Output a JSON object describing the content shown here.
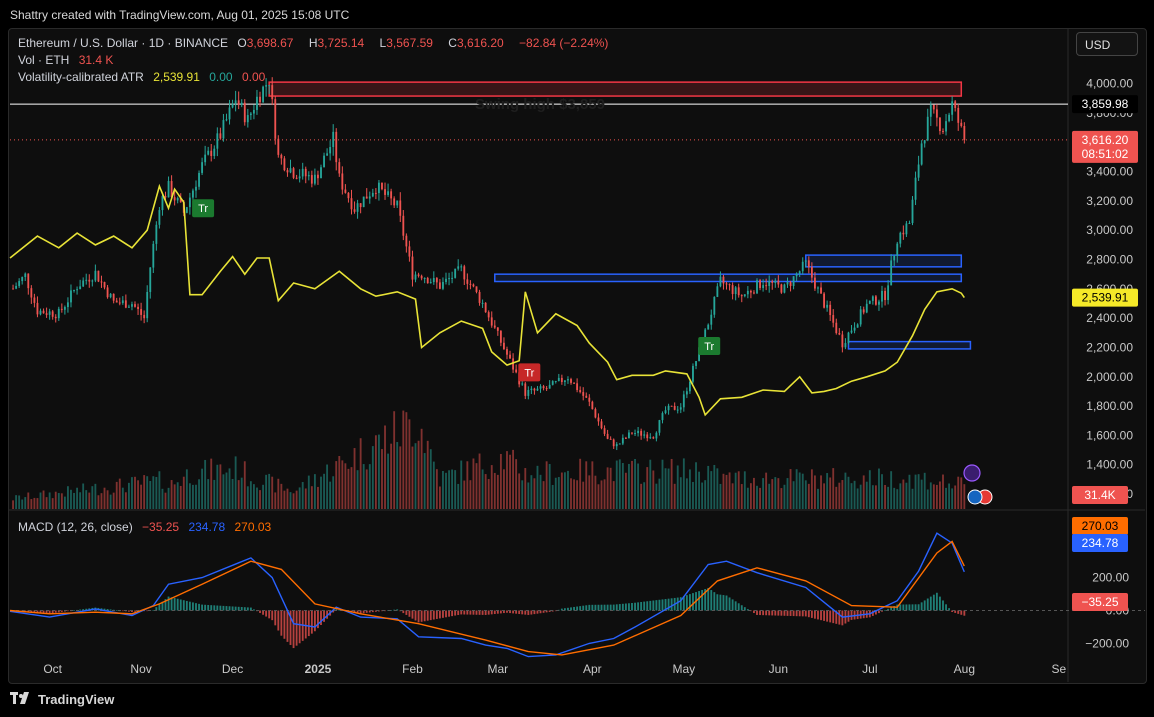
{
  "header": {
    "attribution": "Shattry created with TradingView.com, Aug 01, 2025 15:08 UTC"
  },
  "legend": {
    "symbol": "Ethereum / U.S. Dollar · 1D · BINANCE",
    "o_label": "O",
    "o_val": "3,698.67",
    "h_label": "H",
    "h_val": "3,725.14",
    "l_label": "L",
    "l_val": "3,567.59",
    "c_label": "C",
    "c_val": "3,616.20",
    "chg": "−82.84 (−2.24%)",
    "vol_label": "Vol · ETH",
    "vol_val": "31.4 K",
    "atr_label": "Volatility-calibrated ATR",
    "atr_val": "2,539.91",
    "atr_v2": "0.00",
    "atr_v3": "0.00",
    "macd_label": "MACD (12, 26, close)",
    "macd_hist": "−35.25",
    "macd_line": "234.78",
    "macd_signal": "270.03"
  },
  "currency_button": "USD",
  "footer": {
    "brand": "TradingView"
  },
  "colors": {
    "up": "#26a69a",
    "down": "#ef5350",
    "atr": "#e8e337",
    "macd": "#2962ff",
    "signal": "#ff6d00",
    "zone": "#2962ff",
    "resistance": "#f23645"
  },
  "chart_data": {
    "type": "candlestick",
    "title": "Ethereum / U.S. Dollar · 1D · BINANCE",
    "x_labels": [
      "Oct",
      "Nov",
      "Dec",
      "2025",
      "Feb",
      "Mar",
      "Apr",
      "May",
      "Jun",
      "Jul",
      "Aug",
      "Se"
    ],
    "y_ticks": [
      "4,000.00",
      "3,800.00",
      "3,600.00",
      "3,400.00",
      "3,200.00",
      "3,000.00",
      "2,800.00",
      "2,600.00",
      "2,400.00",
      "2,200.00",
      "2,000.00",
      "1,800.00",
      "1,600.00",
      "1,400.00",
      "1,200.00"
    ],
    "ylim": [
      1180,
      4120
    ],
    "price_path": [
      [
        "2024-09-22",
        2580
      ],
      [
        "2024-09-27",
        2690
      ],
      [
        "2024-10-01",
        2450
      ],
      [
        "2024-10-08",
        2430
      ],
      [
        "2024-10-14",
        2620
      ],
      [
        "2024-10-20",
        2710
      ],
      [
        "2024-10-26",
        2510
      ],
      [
        "2024-11-01",
        2500
      ],
      [
        "2024-11-05",
        2400
      ],
      [
        "2024-11-07",
        2750
      ],
      [
        "2024-11-10",
        3180
      ],
      [
        "2024-11-13",
        3290
      ],
      [
        "2024-11-18",
        3120
      ],
      [
        "2024-11-24",
        3440
      ],
      [
        "2024-11-30",
        3650
      ],
      [
        "2024-12-05",
        3900
      ],
      [
        "2024-12-09",
        3750
      ],
      [
        "2024-12-12",
        3900
      ],
      [
        "2024-12-16",
        4030
      ],
      [
        "2024-12-19",
        3500
      ],
      [
        "2024-12-24",
        3400
      ],
      [
        "2024-12-31",
        3350
      ],
      [
        "2025-01-06",
        3620
      ],
      [
        "2025-01-08",
        3350
      ],
      [
        "2025-01-13",
        3150
      ],
      [
        "2025-01-20",
        3300
      ],
      [
        "2025-01-27",
        3160
      ],
      [
        "2025-02-01",
        2700
      ],
      [
        "2025-02-04",
        2700
      ],
      [
        "2025-02-10",
        2620
      ],
      [
        "2025-02-17",
        2730
      ],
      [
        "2025-02-24",
        2500
      ],
      [
        "2025-03-04",
        2150
      ],
      [
        "2025-03-10",
        1890
      ],
      [
        "2025-03-17",
        1920
      ],
      [
        "2025-03-24",
        2000
      ],
      [
        "2025-03-31",
        1820
      ],
      [
        "2025-04-06",
        1570
      ],
      [
        "2025-04-09",
        1530
      ],
      [
        "2025-04-14",
        1620
      ],
      [
        "2025-04-21",
        1600
      ],
      [
        "2025-04-25",
        1770
      ],
      [
        "2025-04-30",
        1800
      ],
      [
        "2025-05-08",
        2300
      ],
      [
        "2025-05-13",
        2650
      ],
      [
        "2025-05-20",
        2550
      ],
      [
        "2025-05-27",
        2650
      ],
      [
        "2025-06-03",
        2600
      ],
      [
        "2025-06-10",
        2770
      ],
      [
        "2025-06-16",
        2500
      ],
      [
        "2025-06-22",
        2230
      ],
      [
        "2025-06-30",
        2490
      ],
      [
        "2025-07-06",
        2560
      ],
      [
        "2025-07-10",
        2950
      ],
      [
        "2025-07-14",
        3050
      ],
      [
        "2025-07-18",
        3600
      ],
      [
        "2025-07-21",
        3800
      ],
      [
        "2025-07-25",
        3700
      ],
      [
        "2025-07-28",
        3860
      ],
      [
        "2025-08-01",
        3616
      ]
    ],
    "atr_line": [
      [
        "2024-09-22",
        2810
      ],
      [
        "2024-10-01",
        2960
      ],
      [
        "2024-10-08",
        2880
      ],
      [
        "2024-10-14",
        2980
      ],
      [
        "2024-10-20",
        2900
      ],
      [
        "2024-10-26",
        2960
      ],
      [
        "2024-11-01",
        2880
      ],
      [
        "2024-11-06",
        3000
      ],
      [
        "2024-11-10",
        3300
      ],
      [
        "2024-11-13",
        3150
      ],
      [
        "2024-11-15",
        3280
      ],
      [
        "2024-11-18",
        3190
      ],
      [
        "2024-11-20",
        2560
      ],
      [
        "2024-11-24",
        2560
      ],
      [
        "2024-11-30",
        2720
      ],
      [
        "2024-12-04",
        2820
      ],
      [
        "2024-12-08",
        2700
      ],
      [
        "2024-12-12",
        2810
      ],
      [
        "2024-12-16",
        2810
      ],
      [
        "2024-12-19",
        2520
      ],
      [
        "2024-12-24",
        2640
      ],
      [
        "2024-12-31",
        2600
      ],
      [
        "2025-01-08",
        2720
      ],
      [
        "2025-01-15",
        2600
      ],
      [
        "2025-01-20",
        2550
      ],
      [
        "2025-01-27",
        2580
      ],
      [
        "2025-02-02",
        2530
      ],
      [
        "2025-02-04",
        2200
      ],
      [
        "2025-02-10",
        2300
      ],
      [
        "2025-02-17",
        2380
      ],
      [
        "2025-02-24",
        2330
      ],
      [
        "2025-02-27",
        2170
      ],
      [
        "2025-03-04",
        2080
      ],
      [
        "2025-03-08",
        2110
      ],
      [
        "2025-03-10",
        2580
      ],
      [
        "2025-03-14",
        2300
      ],
      [
        "2025-03-20",
        2430
      ],
      [
        "2025-03-27",
        2350
      ],
      [
        "2025-03-31",
        2230
      ],
      [
        "2025-04-06",
        2100
      ],
      [
        "2025-04-09",
        1980
      ],
      [
        "2025-04-14",
        2010
      ],
      [
        "2025-04-21",
        2010
      ],
      [
        "2025-04-25",
        2040
      ],
      [
        "2025-05-02",
        2020
      ],
      [
        "2025-05-06",
        1860
      ],
      [
        "2025-05-08",
        1740
      ],
      [
        "2025-05-13",
        1850
      ],
      [
        "2025-05-20",
        1860
      ],
      [
        "2025-05-27",
        1910
      ],
      [
        "2025-06-03",
        1900
      ],
      [
        "2025-06-08",
        2000
      ],
      [
        "2025-06-12",
        1890
      ],
      [
        "2025-06-16",
        1900
      ],
      [
        "2025-06-20",
        1920
      ],
      [
        "2025-06-25",
        1970
      ],
      [
        "2025-06-30",
        2000
      ],
      [
        "2025-07-06",
        2040
      ],
      [
        "2025-07-10",
        2100
      ],
      [
        "2025-07-15",
        2280
      ],
      [
        "2025-07-19",
        2460
      ],
      [
        "2025-07-23",
        2580
      ],
      [
        "2025-07-28",
        2600
      ],
      [
        "2025-07-31",
        2570
      ],
      [
        "2025-08-01",
        2540
      ]
    ],
    "volume_path": [
      [
        "2024-09-22",
        4
      ],
      [
        "2024-11-10",
        11
      ],
      [
        "2024-11-13",
        9
      ],
      [
        "2024-11-20",
        14
      ],
      [
        "2024-12-06",
        16
      ],
      [
        "2024-12-09",
        13
      ],
      [
        "2024-12-24",
        7
      ],
      [
        "2025-02-03",
        35
      ],
      [
        "2025-02-10",
        12
      ],
      [
        "2025-03-03",
        20
      ],
      [
        "2025-03-10",
        14
      ],
      [
        "2025-04-07",
        15
      ],
      [
        "2025-05-09",
        15
      ],
      [
        "2025-05-13",
        12
      ],
      [
        "2025-06-22",
        12
      ],
      [
        "2025-07-18",
        12
      ],
      [
        "2025-08-01",
        9
      ]
    ],
    "volume_max": 35,
    "macd_line": [
      [
        "2024-09-22",
        -5
      ],
      [
        "2024-10-05",
        -40
      ],
      [
        "2024-10-20",
        10
      ],
      [
        "2024-11-01",
        -30
      ],
      [
        "2024-11-08",
        30
      ],
      [
        "2024-11-13",
        160
      ],
      [
        "2024-11-24",
        200
      ],
      [
        "2024-12-06",
        290
      ],
      [
        "2024-12-10",
        320
      ],
      [
        "2024-12-17",
        200
      ],
      [
        "2024-12-24",
        -80
      ],
      [
        "2024-12-31",
        -100
      ],
      [
        "2025-01-07",
        20
      ],
      [
        "2025-01-15",
        -40
      ],
      [
        "2025-01-27",
        -50
      ],
      [
        "2025-02-03",
        -160
      ],
      [
        "2025-02-17",
        -170
      ],
      [
        "2025-02-25",
        -210
      ],
      [
        "2025-03-04",
        -230
      ],
      [
        "2025-03-11",
        -280
      ],
      [
        "2025-03-20",
        -270
      ],
      [
        "2025-03-31",
        -200
      ],
      [
        "2025-04-08",
        -170
      ],
      [
        "2025-04-15",
        -100
      ],
      [
        "2025-04-30",
        60
      ],
      [
        "2025-05-09",
        280
      ],
      [
        "2025-05-15",
        300
      ],
      [
        "2025-05-25",
        230
      ],
      [
        "2025-06-10",
        140
      ],
      [
        "2025-06-22",
        -40
      ],
      [
        "2025-07-01",
        -20
      ],
      [
        "2025-07-10",
        60
      ],
      [
        "2025-07-17",
        240
      ],
      [
        "2025-07-23",
        470
      ],
      [
        "2025-07-28",
        410
      ],
      [
        "2025-08-01",
        235
      ]
    ],
    "macd_signal": [
      [
        "2024-09-22",
        0
      ],
      [
        "2024-10-05",
        -20
      ],
      [
        "2024-10-20",
        -10
      ],
      [
        "2024-11-01",
        -20
      ],
      [
        "2024-11-10",
        40
      ],
      [
        "2024-11-24",
        160
      ],
      [
        "2024-12-10",
        300
      ],
      [
        "2024-12-20",
        250
      ],
      [
        "2024-12-31",
        40
      ],
      [
        "2025-01-15",
        -20
      ],
      [
        "2025-02-03",
        -80
      ],
      [
        "2025-02-25",
        -180
      ],
      [
        "2025-03-11",
        -250
      ],
      [
        "2025-03-22",
        -270
      ],
      [
        "2025-04-08",
        -210
      ],
      [
        "2025-04-30",
        -30
      ],
      [
        "2025-05-12",
        180
      ],
      [
        "2025-05-25",
        260
      ],
      [
        "2025-06-10",
        180
      ],
      [
        "2025-06-25",
        30
      ],
      [
        "2025-07-10",
        20
      ],
      [
        "2025-07-23",
        350
      ],
      [
        "2025-07-28",
        420
      ],
      [
        "2025-08-01",
        270
      ]
    ],
    "macd_ylim": [
      -240,
      520
    ],
    "macd_ticks": [
      "200.00",
      "0.00",
      "−200.00"
    ],
    "swing_high": {
      "label": "Swing high $3,859",
      "value": 3859.98,
      "value_label": "3,859.98"
    },
    "resistance_zone": {
      "from": "2024-12-16",
      "to": "2025-07-31",
      "low": 3915,
      "high": 4010
    },
    "demand_zones": [
      {
        "from": "2025-02-28",
        "to": "2025-07-31",
        "low": 2650,
        "high": 2700
      },
      {
        "from": "2025-06-10",
        "to": "2025-07-31",
        "low": 2750,
        "high": 2830
      },
      {
        "from": "2025-06-24",
        "to": "2025-08-03",
        "low": 2190,
        "high": 2240
      }
    ],
    "markers": [
      {
        "date": "2024-11-24",
        "price": 3150,
        "label": "Tr",
        "kind": "up"
      },
      {
        "date": "2025-03-11",
        "price": 2030,
        "label": "Tr",
        "kind": "down"
      },
      {
        "date": "2025-05-09",
        "price": 2210,
        "label": "Tr",
        "kind": "up"
      }
    ],
    "last_price": {
      "value": 3616.2,
      "label": "3,616.20",
      "countdown": "08:51:02"
    },
    "atr_badge": "2,539.91",
    "vol_badge": "31.4K",
    "macd_badges": {
      "signal": "270.03",
      "macd": "234.78",
      "hist": "−35.25"
    }
  }
}
